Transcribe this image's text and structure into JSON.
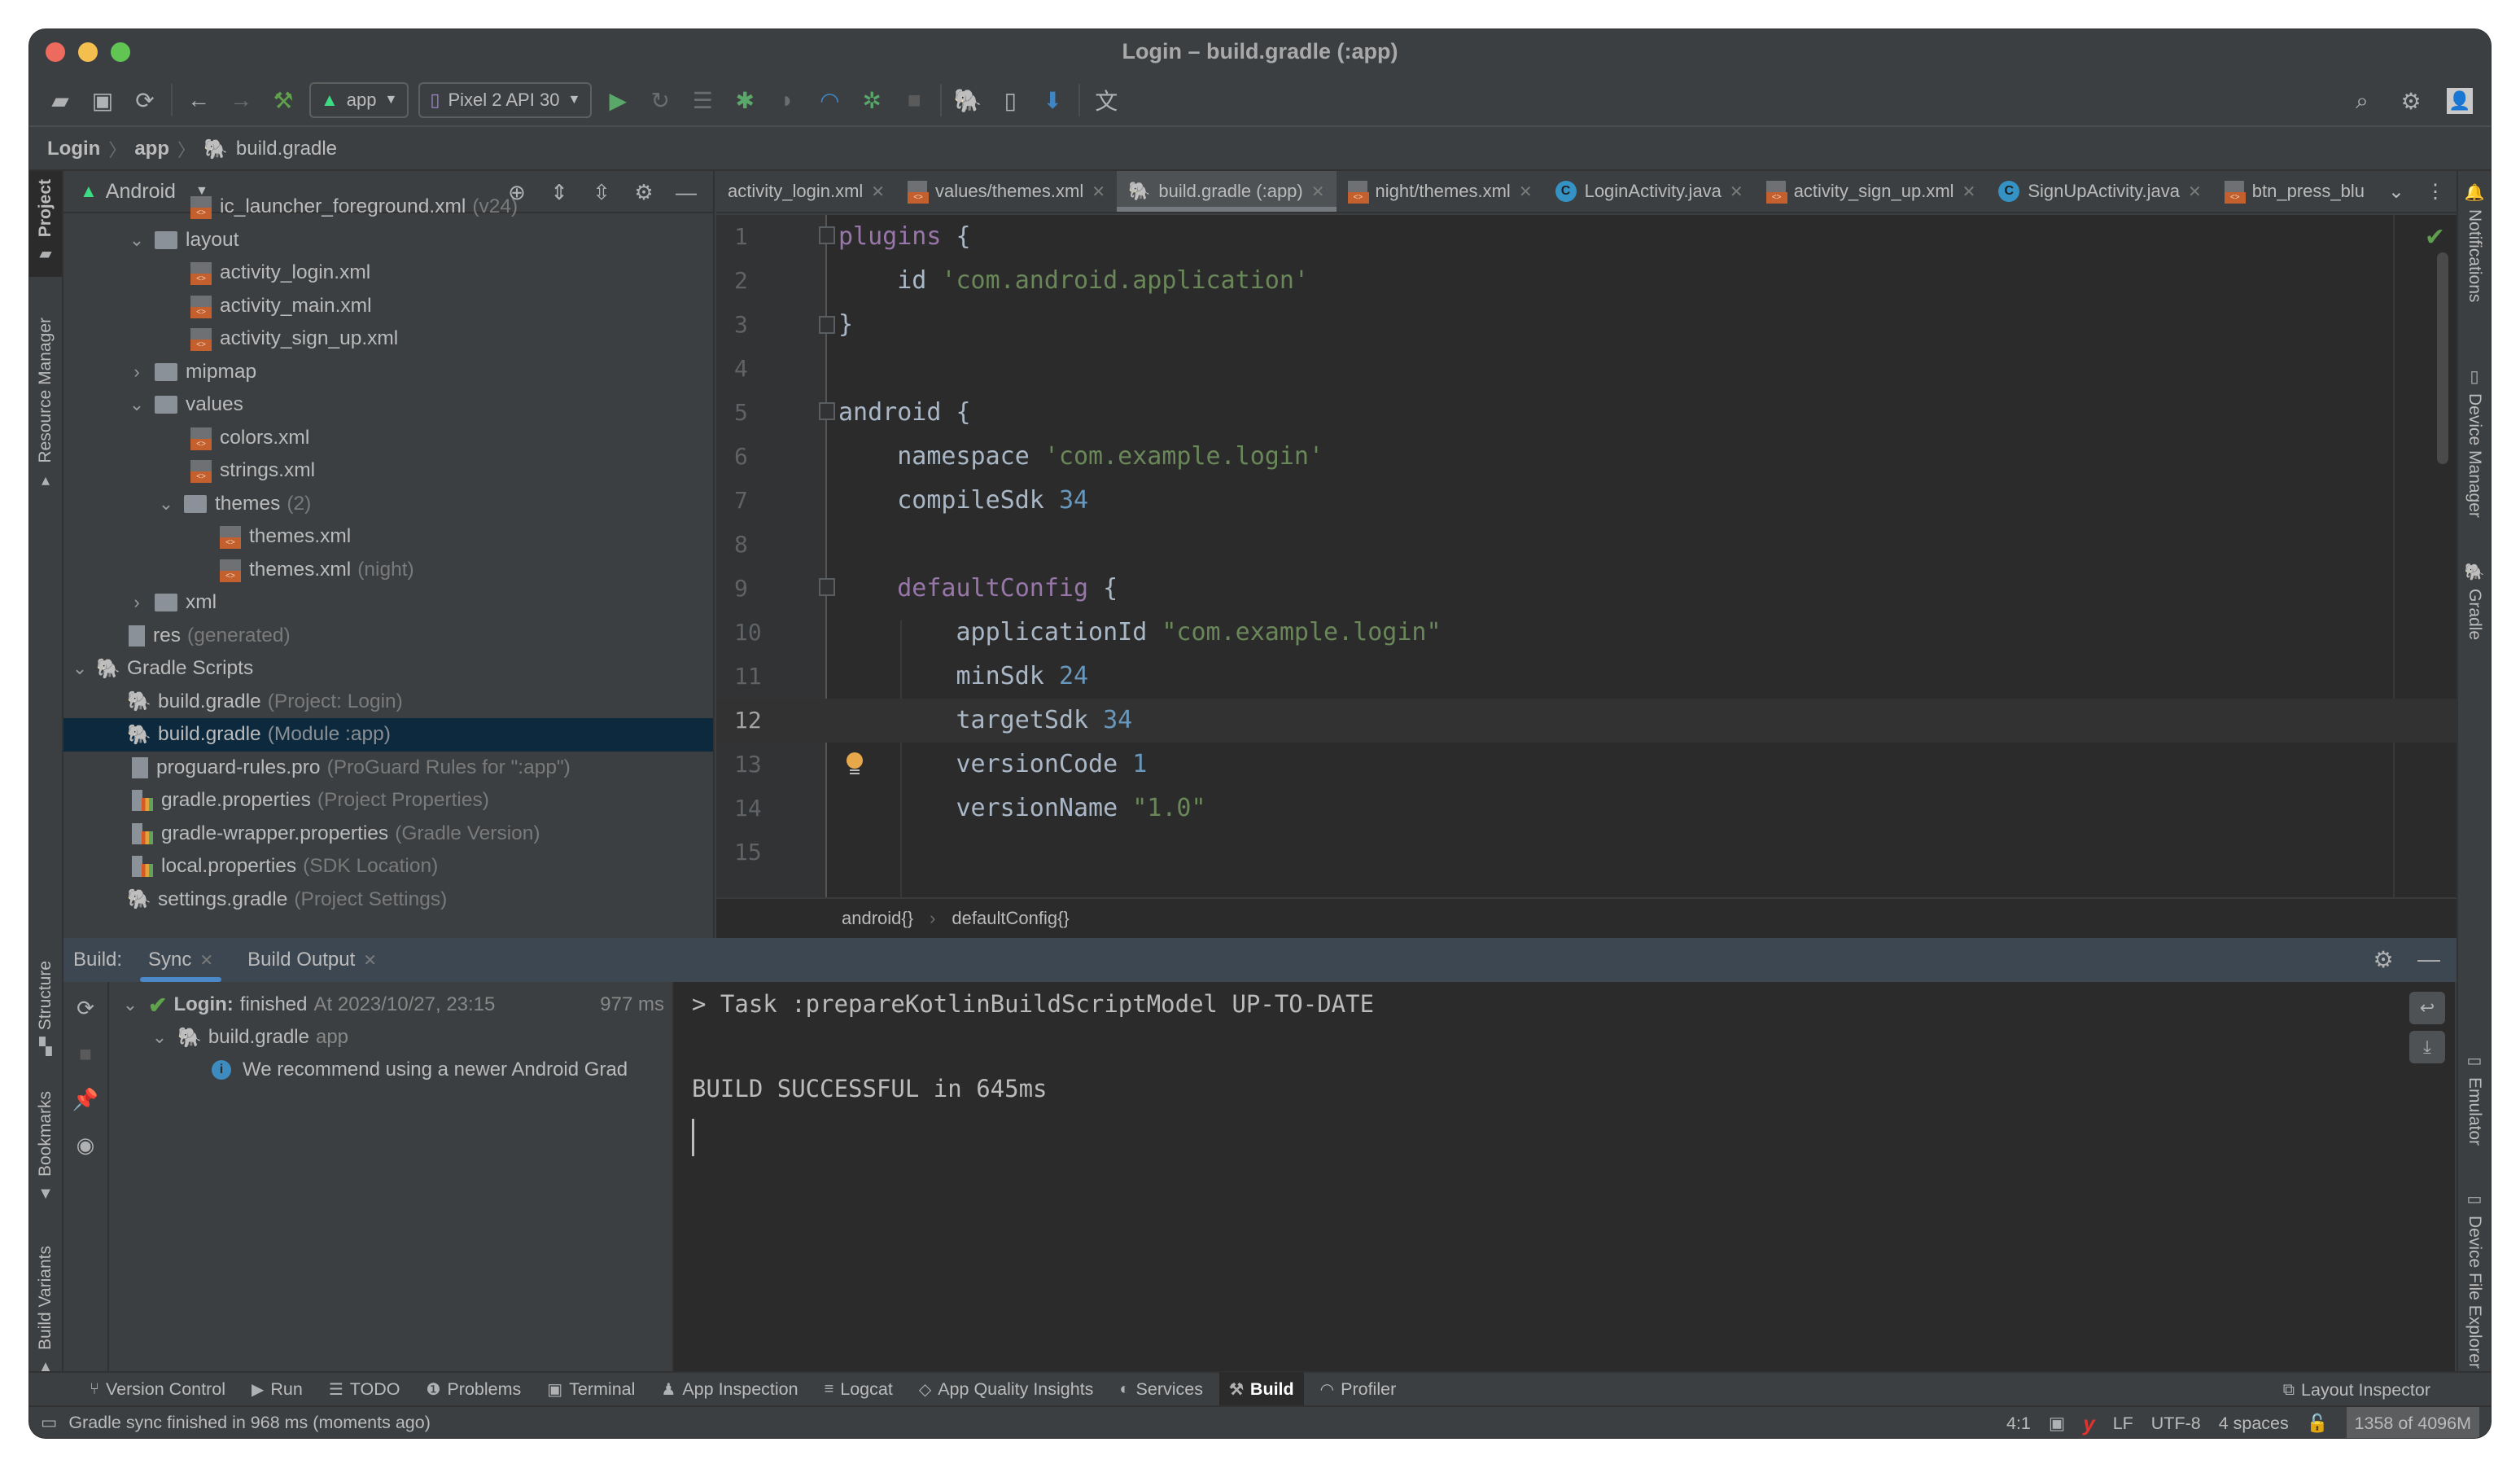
{
  "window": {
    "title": "Login – build.gradle (:app)"
  },
  "toolbar": {
    "run_config": "app",
    "device": "Pixel 2 API 30",
    "icons": [
      "open-folder-icon",
      "save-icon",
      "sync-icon",
      "back-icon",
      "forward-icon",
      "make-project-icon",
      "run-icon",
      "apply-changes-icon",
      "apply-code-changes-icon",
      "debug-icon",
      "run-coverage-icon",
      "profile-icon",
      "attach-debugger-icon",
      "stop-icon",
      "sync-gradle-icon",
      "device-manager-icon",
      "sdk-manager-icon",
      "translate-icon",
      "search-icon",
      "settings-icon",
      "avatar-icon"
    ]
  },
  "navbar": {
    "crumbs": [
      "Login",
      "app",
      "build.gradle"
    ]
  },
  "left_strip": {
    "tabs": [
      "Project",
      "Resource Manager",
      "Structure",
      "Bookmarks",
      "Build Variants"
    ]
  },
  "right_strip": {
    "tabs": [
      "Notifications",
      "Device Manager",
      "Gradle",
      "Emulator",
      "Device File Explorer"
    ]
  },
  "project": {
    "view_mode": "Android",
    "tree": [
      {
        "name": "ic_launcher_foreground.xml",
        "hint": "(v24)"
      },
      {
        "name": "layout",
        "hint": ""
      },
      {
        "name": "activity_login.xml",
        "hint": ""
      },
      {
        "name": "activity_main.xml",
        "hint": ""
      },
      {
        "name": "activity_sign_up.xml",
        "hint": ""
      },
      {
        "name": "mipmap",
        "hint": ""
      },
      {
        "name": "values",
        "hint": ""
      },
      {
        "name": "colors.xml",
        "hint": ""
      },
      {
        "name": "strings.xml",
        "hint": ""
      },
      {
        "name": "themes",
        "hint": "(2)"
      },
      {
        "name": "themes.xml",
        "hint": ""
      },
      {
        "name": "themes.xml",
        "hint": "(night)"
      },
      {
        "name": "xml",
        "hint": ""
      },
      {
        "name": "res",
        "hint": "(generated)"
      },
      {
        "name": "Gradle Scripts",
        "hint": ""
      },
      {
        "name": "build.gradle",
        "hint": "(Project: Login)"
      },
      {
        "name": "build.gradle",
        "hint": "(Module :app)"
      },
      {
        "name": "proguard-rules.pro",
        "hint": "(ProGuard Rules for \":app\")"
      },
      {
        "name": "gradle.properties",
        "hint": "(Project Properties)"
      },
      {
        "name": "gradle-wrapper.properties",
        "hint": "(Gradle Version)"
      },
      {
        "name": "local.properties",
        "hint": "(SDK Location)"
      },
      {
        "name": "settings.gradle",
        "hint": "(Project Settings)"
      }
    ]
  },
  "tabs": [
    {
      "label": "activity_login.xml"
    },
    {
      "label": "values/themes.xml"
    },
    {
      "label": "build.gradle (:app)"
    },
    {
      "label": "night/themes.xml"
    },
    {
      "label": "LoginActivity.java"
    },
    {
      "label": "activity_sign_up.xml"
    },
    {
      "label": "SignUpActivity.java"
    },
    {
      "label": "btn_press_blu"
    }
  ],
  "editor": {
    "line_numbers": [
      "1",
      "2",
      "3",
      "4",
      "5",
      "6",
      "7",
      "8",
      "9",
      "10",
      "11",
      "12",
      "13",
      "14",
      "15"
    ],
    "current_line": 12,
    "code": {
      "l1_kw": "plugins",
      "l1_rest": " {",
      "l2_a": "    id ",
      "l2_s": "'com.android.application'",
      "l3": "}",
      "l5_kw": "android",
      "l5_rest": " {",
      "l6_a": "    namespace ",
      "l6_s": "'com.example.login'",
      "l7_a": "    compileSdk ",
      "l7_n": "34",
      "l9_kw": "defaultConfig",
      "l9_rest": " {",
      "l10_a": "        applicationId ",
      "l10_s": "\"com.example.login\"",
      "l11_a": "        minSdk ",
      "l11_n": "24",
      "l12_a": "        targetSdk ",
      "l12_n": "34",
      "l13_a": "        versionCode ",
      "l13_n": "1",
      "l14_a": "        versionName ",
      "l14_s": "\"1.0\""
    },
    "breadcrumbs": [
      "android{}",
      "defaultConfig{}"
    ]
  },
  "build": {
    "label": "Build:",
    "tabs": [
      "Sync",
      "Build Output"
    ],
    "tree": {
      "root_name": "Login:",
      "root_status": "finished",
      "root_time": "At 2023/10/27, 23:15",
      "root_duration": "977 ms",
      "child_name": "build.gradle",
      "child_hint": "app",
      "message": "We recommend using a newer Android Grad"
    },
    "console": [
      "> Task :prepareKotlinBuildScriptModel UP-TO-DATE",
      "",
      "BUILD SUCCESSFUL in 645ms"
    ]
  },
  "tool_windows": [
    {
      "label": "Version Control",
      "icon": "⑂"
    },
    {
      "label": "Run",
      "icon": "▶"
    },
    {
      "label": "TODO",
      "icon": "☰"
    },
    {
      "label": "Problems",
      "icon": "❶"
    },
    {
      "label": "Terminal",
      "icon": "▣"
    },
    {
      "label": "App Inspection",
      "icon": "♟"
    },
    {
      "label": "Logcat",
      "icon": "≡"
    },
    {
      "label": "App Quality Insights",
      "icon": "◇"
    },
    {
      "label": "Services",
      "icon": "◐"
    },
    {
      "label": "Build",
      "icon": "⚒"
    },
    {
      "label": "Profiler",
      "icon": "◠"
    }
  ],
  "layout_inspector": "Layout Inspector",
  "status": {
    "message": "Gradle sync finished in 968 ms (moments ago)",
    "position": "4:1",
    "line_sep": "LF",
    "encoding": "UTF-8",
    "indent": "4 spaces",
    "memory": "1358 of 4096M"
  }
}
